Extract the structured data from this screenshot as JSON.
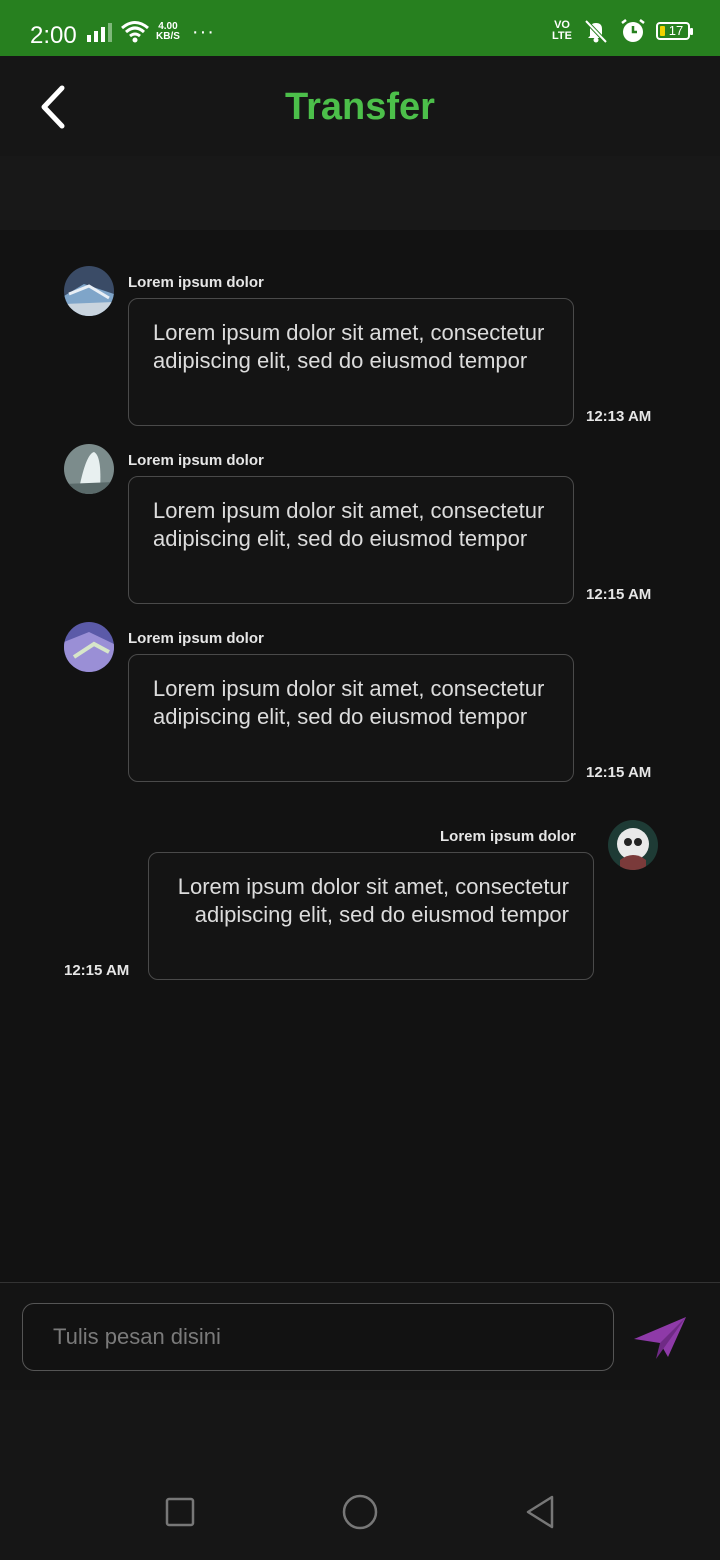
{
  "status_bar": {
    "time": "2:00",
    "net_speed_value": "4.00",
    "net_speed_unit": "KB/S",
    "more": "···",
    "volte_top": "VO",
    "volte_bottom": "LTE",
    "battery": "17"
  },
  "header": {
    "title": "Transfer",
    "back_icon": "chevron-left-icon"
  },
  "messages": [
    {
      "sender": "Lorem ipsum dolor",
      "text": "Lorem ipsum dolor sit amet, consectetur adipiscing elit, sed do eiusmod tempor",
      "time": "12:13 AM",
      "side": "left"
    },
    {
      "sender": "Lorem ipsum dolor",
      "text": "Lorem ipsum dolor sit amet, consectetur adipiscing elit, sed do eiusmod tempor",
      "time": "12:15 AM",
      "side": "left"
    },
    {
      "sender": "Lorem ipsum dolor",
      "text": "Lorem ipsum dolor sit amet, consectetur adipiscing elit, sed do eiusmod tempor",
      "time": "12:15 AM",
      "side": "left"
    },
    {
      "sender": "Lorem ipsum dolor",
      "text": "Lorem ipsum dolor sit amet, consectetur adipiscing elit, sed do eiusmod tempor",
      "time": "12:15 AM",
      "side": "right"
    }
  ],
  "composer": {
    "placeholder": "Tulis pesan disini",
    "value": "",
    "send_icon": "send-icon"
  },
  "colors": {
    "status_bar": "#27801f",
    "title": "#4cbf4a",
    "send": "#8e3aa8",
    "background": "#121212"
  },
  "nav_bar": {
    "icons": [
      "recents-square-icon",
      "home-circle-icon",
      "back-triangle-icon"
    ]
  }
}
